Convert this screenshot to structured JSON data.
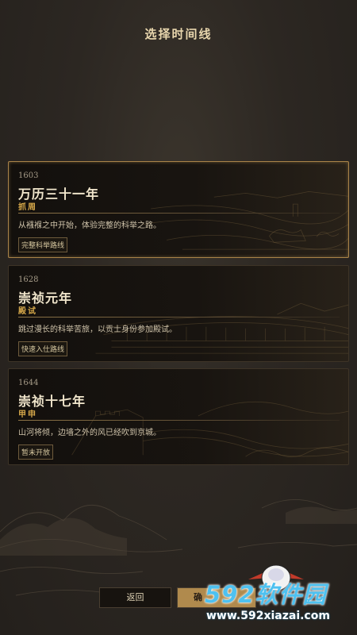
{
  "header": {
    "title": "选择时间线"
  },
  "timelines": [
    {
      "year": "1603",
      "name": "万历三十一年",
      "subtitle": "抓周",
      "description": "从襁褓之中开始，体验完整的科举之路。",
      "tag": "完整科举路线",
      "selected": true
    },
    {
      "year": "1628",
      "name": "崇祯元年",
      "subtitle": "殿试",
      "description": "跳过漫长的科举苦旅，以贡士身份参加殿试。",
      "tag": "快速入仕路线",
      "selected": false
    },
    {
      "year": "1644",
      "name": "崇祯十七年",
      "subtitle": "甲申",
      "description": "山河将倾，边墙之外的风已经吹到京城。",
      "tag": "暂未开放",
      "selected": false
    }
  ],
  "footer": {
    "back_label": "返回",
    "confirm_label": "确"
  },
  "watermark": {
    "brand": "592软件园",
    "url": "www.592xiazai.com"
  },
  "colors": {
    "accent_gold": "#d6a84a",
    "selected_border": "#a98348",
    "watermark_blue": "#4ec1f0"
  }
}
